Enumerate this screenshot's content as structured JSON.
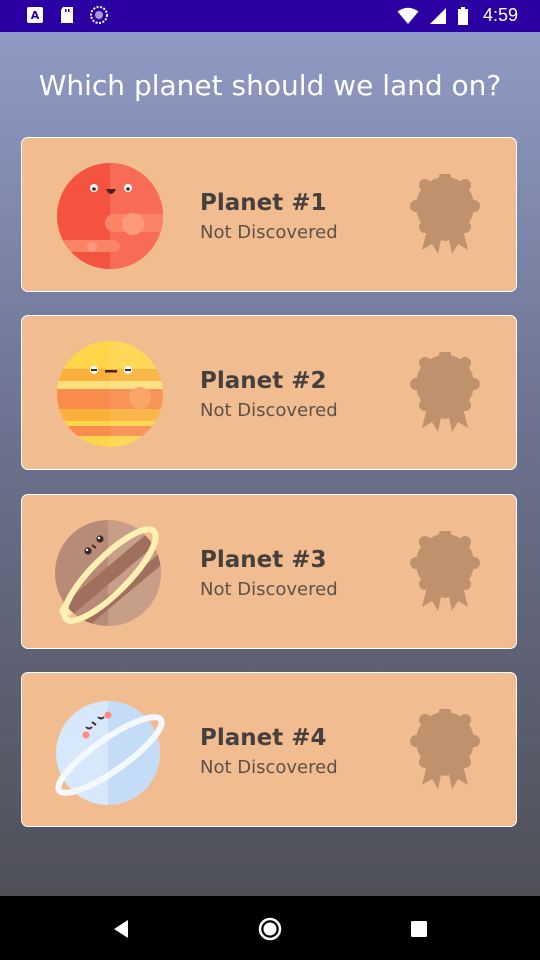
{
  "status_bar": {
    "time": "4:59",
    "left_icons": [
      "keyboard-a-icon",
      "sd-card-icon",
      "sync-circle-icon"
    ],
    "right_icons": [
      "wifi-icon",
      "signal-icon",
      "battery-icon"
    ]
  },
  "screen": {
    "title": "Which planet should we land on?"
  },
  "planets": [
    {
      "name": "Planet #1",
      "status": "Not Discovered",
      "icon": "red-planet-icon",
      "color": "#f4533f"
    },
    {
      "name": "Planet #2",
      "status": "Not Discovered",
      "icon": "striped-yellow-planet-icon",
      "color": "#ffd54a"
    },
    {
      "name": "Planet #3",
      "status": "Not Discovered",
      "icon": "brown-ringed-planet-icon",
      "color": "#b88a78"
    },
    {
      "name": "Planet #4",
      "status": "Not Discovered",
      "icon": "blue-ringed-planet-icon",
      "color": "#d7e8fb"
    }
  ],
  "colors": {
    "status_bar": "#2b00a3",
    "card_background": "#f1bc90",
    "card_border": "#ffffff",
    "badge": "#c0916d",
    "gradient_top": "#8f9ac4",
    "gradient_bottom": "#4f5058"
  },
  "nav_bar": {
    "buttons": [
      "back-icon",
      "home-icon",
      "recents-icon"
    ]
  }
}
